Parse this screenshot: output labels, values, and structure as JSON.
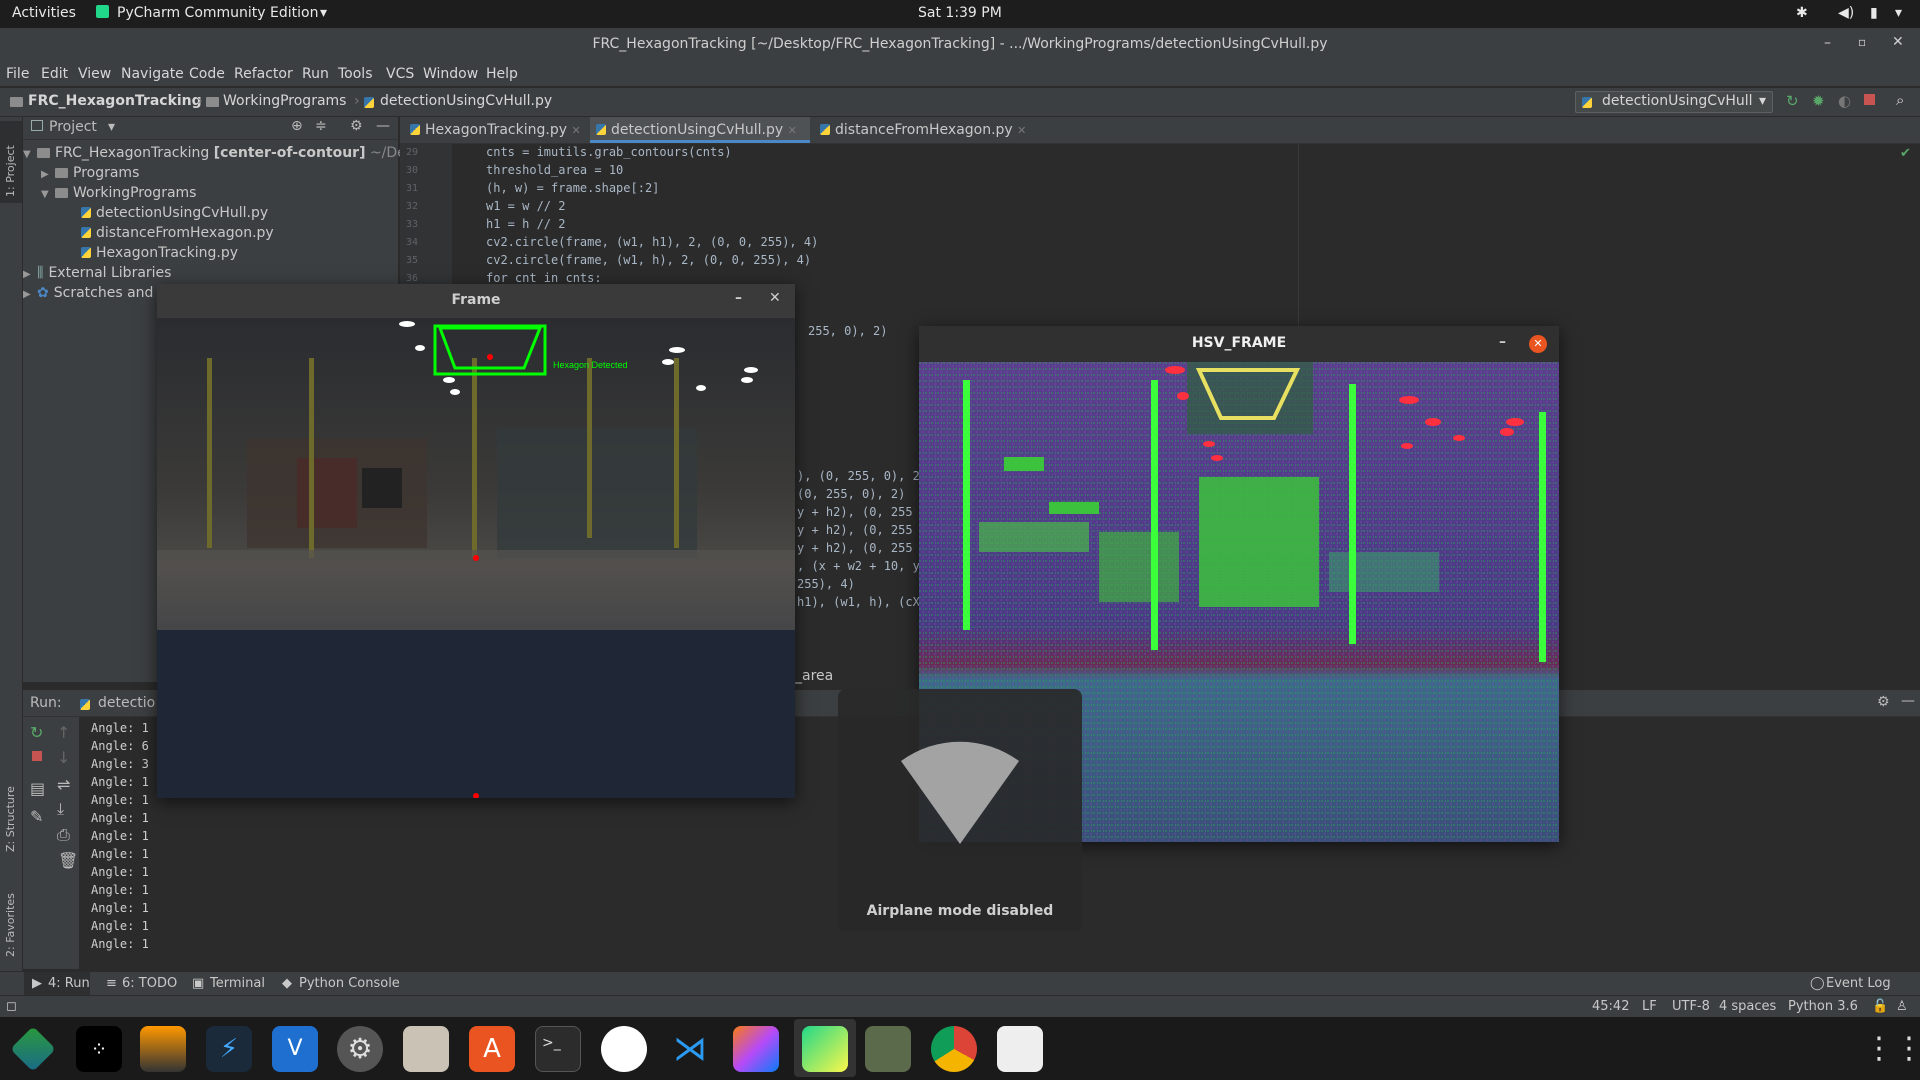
{
  "topbar": {
    "activities": "Activities",
    "app_menu": "PyCharm Community Edition",
    "clock": "Sat  1:39 PM"
  },
  "window": {
    "title": "FRC_HexagonTracking [~/Desktop/FRC_HexagonTracking] - .../WorkingPrograms/detectionUsingCvHull.py"
  },
  "menu": [
    "File",
    "Edit",
    "View",
    "Navigate",
    "Code",
    "Refactor",
    "Run",
    "Tools",
    "VCS",
    "Window",
    "Help"
  ],
  "breadcrumb": [
    "FRC_HexagonTracking",
    "WorkingPrograms",
    "detectionUsingCvHull.py"
  ],
  "run_config": "detectionUsingCvHull",
  "project_panel": {
    "header": "Project",
    "tree": [
      {
        "label": "FRC_HexagonTracking",
        "extra": "[center-of-contour]",
        "path": "~/De",
        "type": "folder"
      },
      {
        "label": "Programs",
        "type": "folder"
      },
      {
        "label": "WorkingPrograms",
        "type": "folder"
      },
      {
        "label": "detectionUsingCvHull.py",
        "type": "file"
      },
      {
        "label": "distanceFromHexagon.py",
        "type": "file"
      },
      {
        "label": "HexagonTracking.py",
        "type": "file"
      },
      {
        "label": "External Libraries",
        "type": "lib"
      },
      {
        "label": "Scratches and",
        "type": "lib"
      }
    ]
  },
  "left_strip": {
    "project": "1: Project",
    "structure": "Z: Structure",
    "favorites": "2: Favorites"
  },
  "tabs": [
    {
      "label": "HexagonTracking.py",
      "active": false
    },
    {
      "label": "detectionUsingCvHull.py",
      "active": true
    },
    {
      "label": "distanceFromHexagon.py",
      "active": false
    }
  ],
  "code_lines": [
    {
      "num": "29",
      "text": "cnts = imutils.grab_contours(cnts)"
    },
    {
      "num": "30",
      "text": "threshold_area = 10"
    },
    {
      "num": "31",
      "text": "(h, w) = frame.shape[:2]"
    },
    {
      "num": "32",
      "text": "w1 = w // 2"
    },
    {
      "num": "33",
      "text": "h1 = h // 2"
    },
    {
      "num": "34",
      "text": "cv2.circle(frame, (w1, h1), 2, (0, 0, 255), 4)"
    },
    {
      "num": "35",
      "text": "cv2.circle(frame, (w1, h), 2, (0, 0, 255), 4)"
    },
    {
      "num": "36",
      "text": "for cnt in cnts:"
    }
  ],
  "code_fragments": [
    "255, 0), 2)",
    "), (0, 255, 0), 2",
    "(0, 255, 0), 2)",
    "y + h2), (0, 255",
    "y + h2), (0, 255",
    "y + h2), (0, 255",
    ", (x + w2 + 10, y",
    "255), 4)",
    "h1), (w1, h), (cX",
    "_area"
  ],
  "run_panel": {
    "label": "Run:",
    "config": "detectio",
    "output": [
      "Angle: 1",
      "Angle: 6",
      "Angle: 3",
      "Angle: 1",
      "Angle: 1",
      "Angle: 1",
      "Angle: 1",
      "Angle: 1",
      "Angle: 1",
      "Angle: 1",
      "Angle: 1",
      "Angle: 1",
      "Angle: 1"
    ]
  },
  "bottom_tabs": {
    "run": "4: Run",
    "todo": "6: TODO",
    "terminal": "Terminal",
    "console": "Python Console",
    "event_log": "Event Log"
  },
  "status": {
    "position": "45:42",
    "line_sep": "LF",
    "encoding": "UTF-8",
    "indent": "4 spaces",
    "interpreter": "Python 3.6"
  },
  "frame_window": {
    "title": "Frame",
    "overlay_text": "Hexagon Detected"
  },
  "hsv_window": {
    "title": "HSV_FRAME"
  },
  "osd": {
    "text": "Airplane mode disabled"
  },
  "dock_apps": [
    "app-1",
    "tidal",
    "sublime-text",
    "app-4",
    "vscode-alt",
    "settings",
    "files",
    "software-center",
    "terminal",
    "slack",
    "vscode",
    "intellij",
    "pycharm",
    "minecraft",
    "chrome",
    "text-editor",
    "show-apps"
  ]
}
